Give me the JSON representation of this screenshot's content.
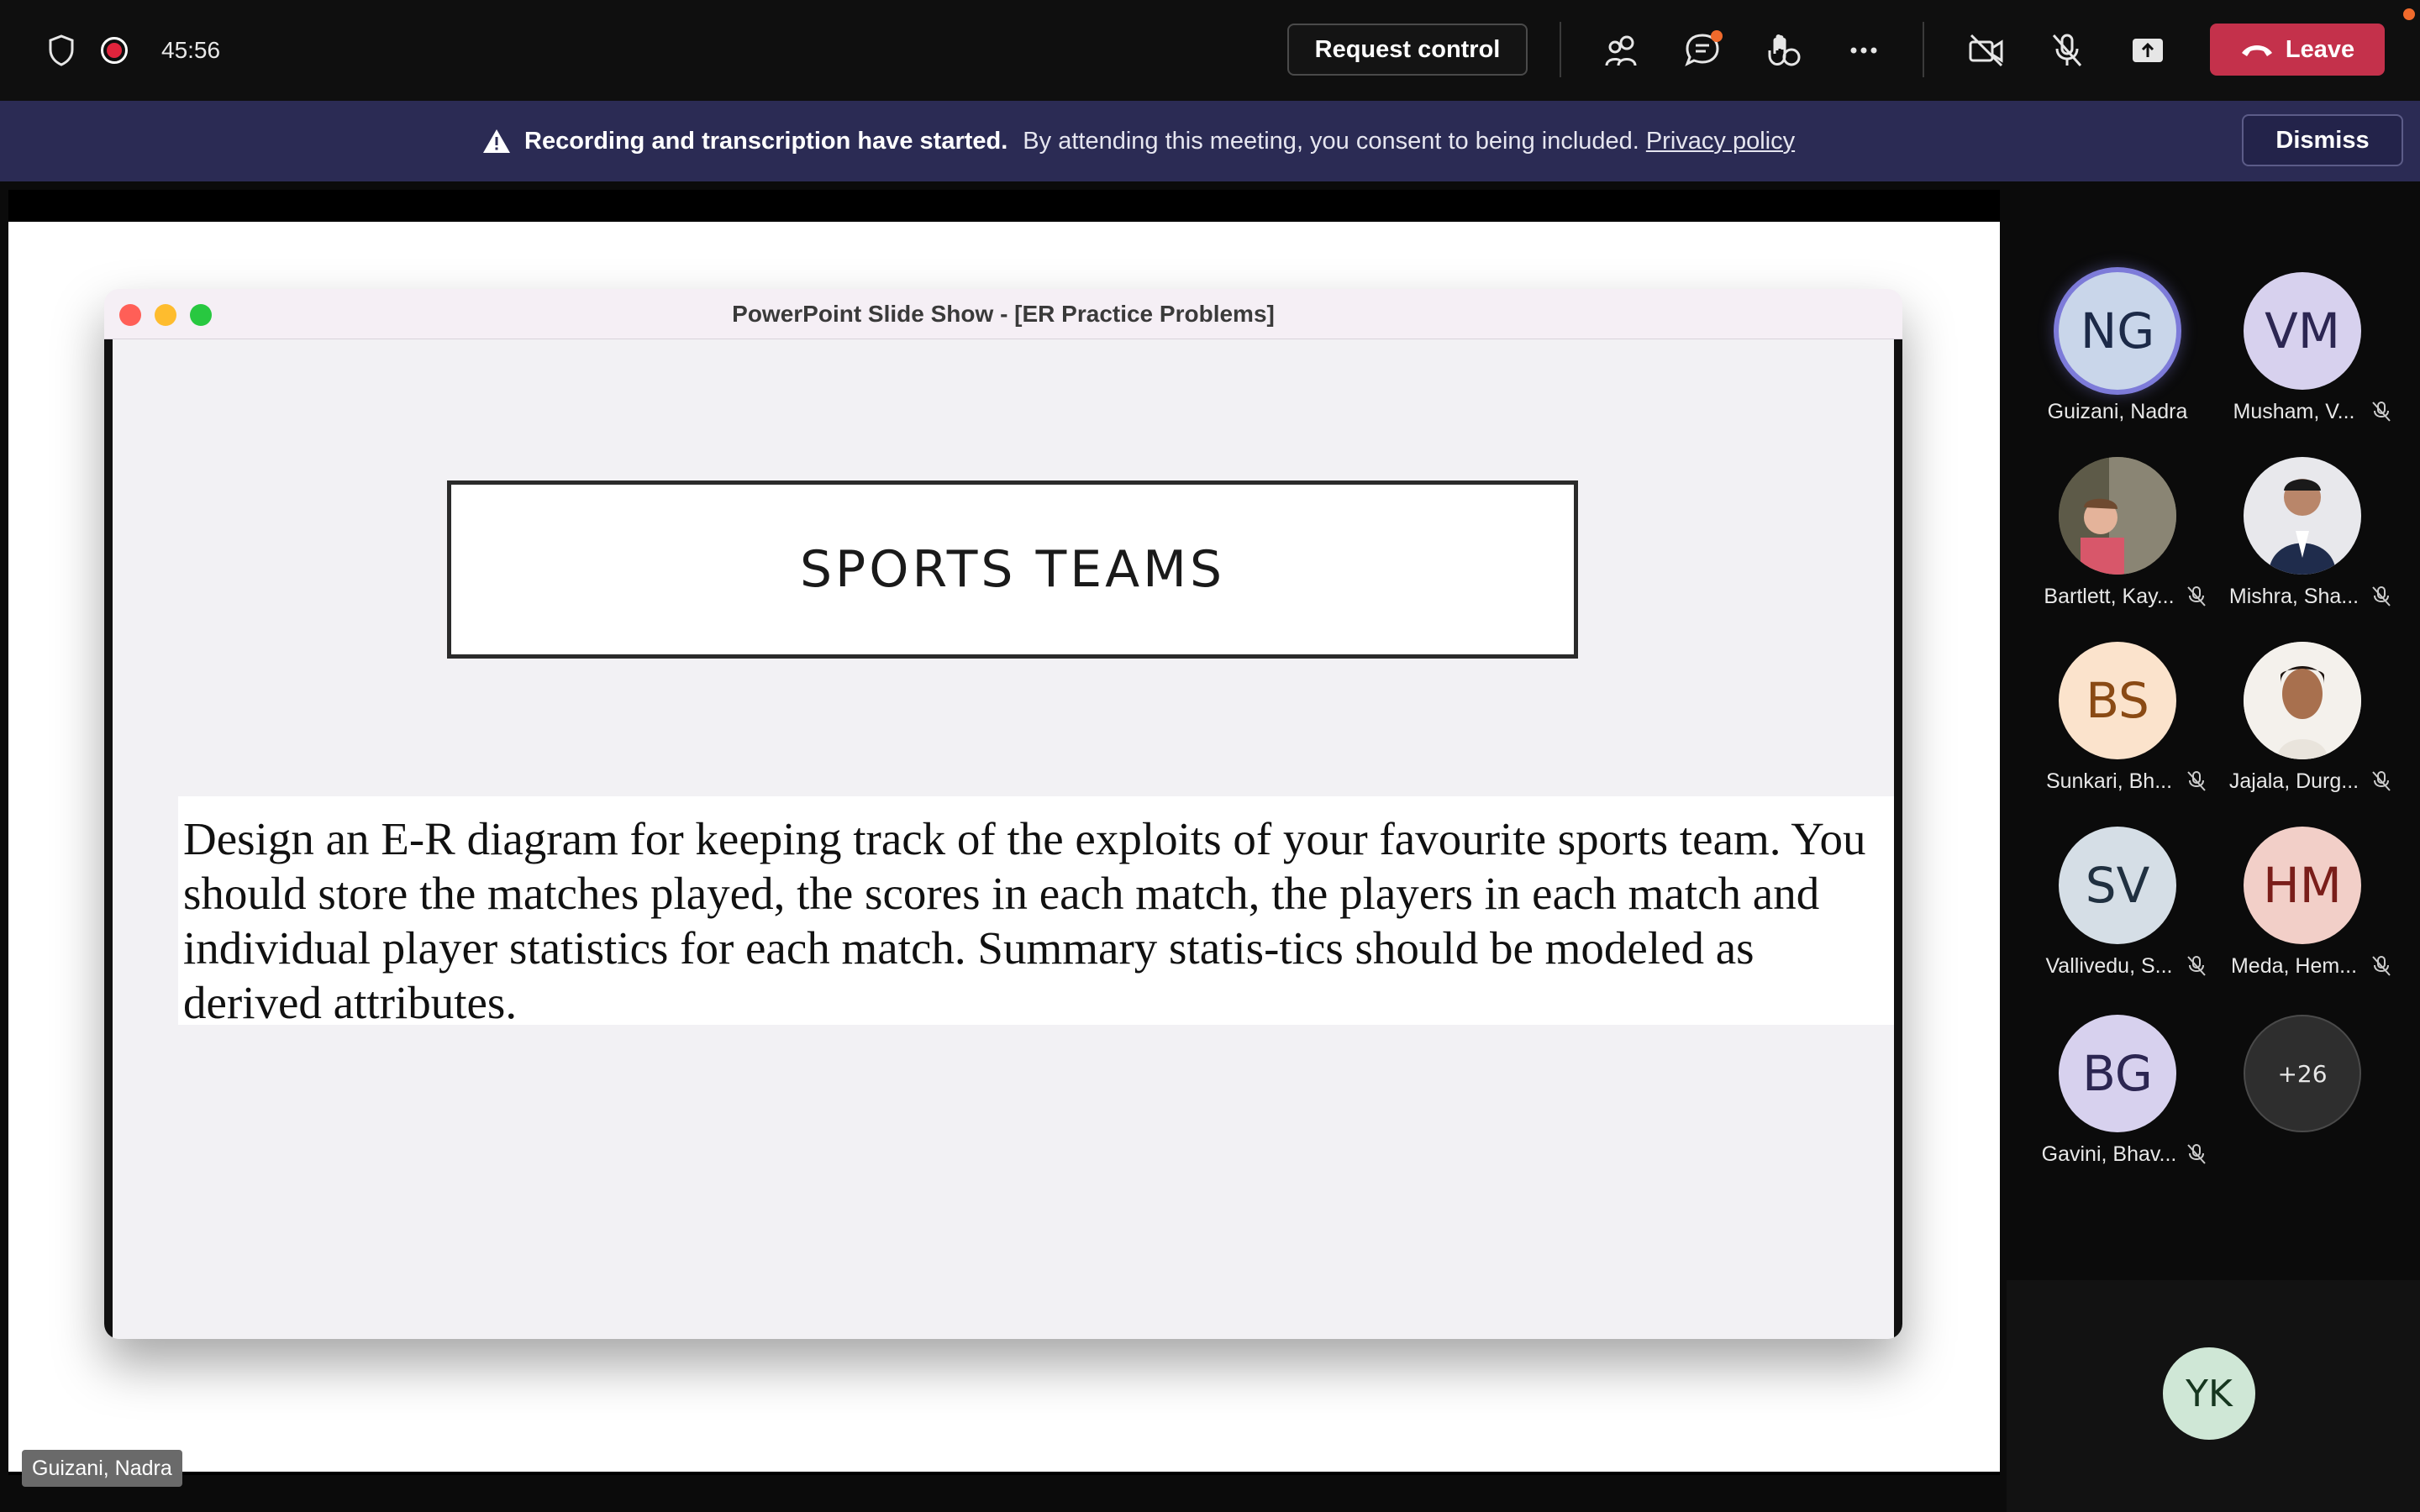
{
  "toolbar": {
    "timer": "45:56",
    "request_control_label": "Request control",
    "leave_label": "Leave"
  },
  "banner": {
    "bold_text": "Recording and transcription have started.",
    "text": "By attending this meeting, you consent to being included.",
    "link_text": "Privacy policy",
    "dismiss_label": "Dismiss"
  },
  "shared_screen": {
    "window_title": "PowerPoint Slide Show - [ER Practice Problems]",
    "slide_title": "SPORTS TEAMS",
    "slide_body": "Design an E-R diagram for keeping track of the exploits of your favourite sports team. You should store the matches played, the scores in each match, the players in each match and individual player statistics for each match. Summary statis-tics should be modeled as derived attributes.",
    "presenter_name": "Guizani, Nadra"
  },
  "participants": [
    {
      "initials": "NG",
      "name": "Guizani, Nadra",
      "muted": false,
      "speaking": true,
      "bg": "#c9d6ea",
      "fg": "#1c2a48"
    },
    {
      "initials": "VM",
      "name": "Musham, V...",
      "muted": true,
      "speaking": false,
      "bg": "#d7d1ee",
      "fg": "#2c2652"
    },
    {
      "initials": "",
      "name": "Bartlett, Kay...",
      "muted": true,
      "speaking": false,
      "photo": true,
      "bg": "#6b6450"
    },
    {
      "initials": "",
      "name": "Mishra, Sha...",
      "muted": true,
      "speaking": false,
      "photo": true,
      "bg": "#2f3a52"
    },
    {
      "initials": "BS",
      "name": "Sunkari, Bh...",
      "muted": true,
      "speaking": false,
      "bg": "#fbe3cc",
      "fg": "#8a4a14"
    },
    {
      "initials": "",
      "name": "Jajala, Durg...",
      "muted": true,
      "speaking": false,
      "photo": true,
      "bg": "#f3efe9"
    },
    {
      "initials": "SV",
      "name": "Vallivedu, S...",
      "muted": true,
      "speaking": false,
      "bg": "#d5dee6",
      "fg": "#203040"
    },
    {
      "initials": "HM",
      "name": "Meda, Hem...",
      "muted": true,
      "speaking": false,
      "bg": "#f2cfc8",
      "fg": "#7a1e1a"
    },
    {
      "initials": "BG",
      "name": "Gavini, Bhav...",
      "muted": true,
      "speaking": false,
      "bg": "#d7d1ee",
      "fg": "#2c2652"
    },
    {
      "initials": "+26",
      "name": "",
      "muted": false,
      "speaking": false,
      "bg": "#2e2e2e",
      "fg": "#e6e6e6",
      "overflow": true
    }
  ],
  "self": {
    "initials": "YK"
  },
  "colors": {
    "leave_red": "#c4314b",
    "banner_bg": "#2b2b54",
    "recording_red": "#e0243c",
    "notification_orange": "#f06a2c",
    "speaking_ring": "#7d7bd9"
  }
}
